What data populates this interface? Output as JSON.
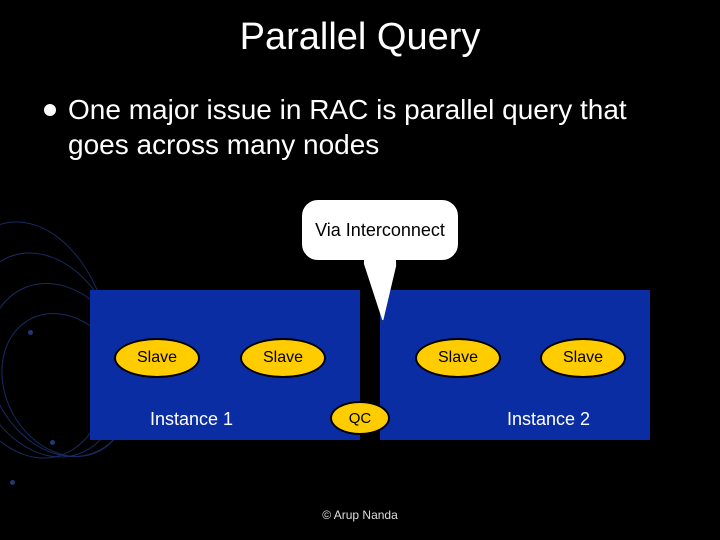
{
  "title": "Parallel Query",
  "bullet": "One major issue in RAC is parallel query that goes across many nodes",
  "callout": "Via Interconnect",
  "instances": [
    {
      "label": "Instance 1",
      "slaves": [
        "Slave",
        "Slave"
      ]
    },
    {
      "label": "Instance 2",
      "slaves": [
        "Slave",
        "Slave"
      ]
    }
  ],
  "qc": "QC",
  "footer": "© Arup Nanda",
  "colors": {
    "background": "#000000",
    "instance": "#0b2da3",
    "node": "#ffcc00",
    "text_light": "#ffffff"
  }
}
